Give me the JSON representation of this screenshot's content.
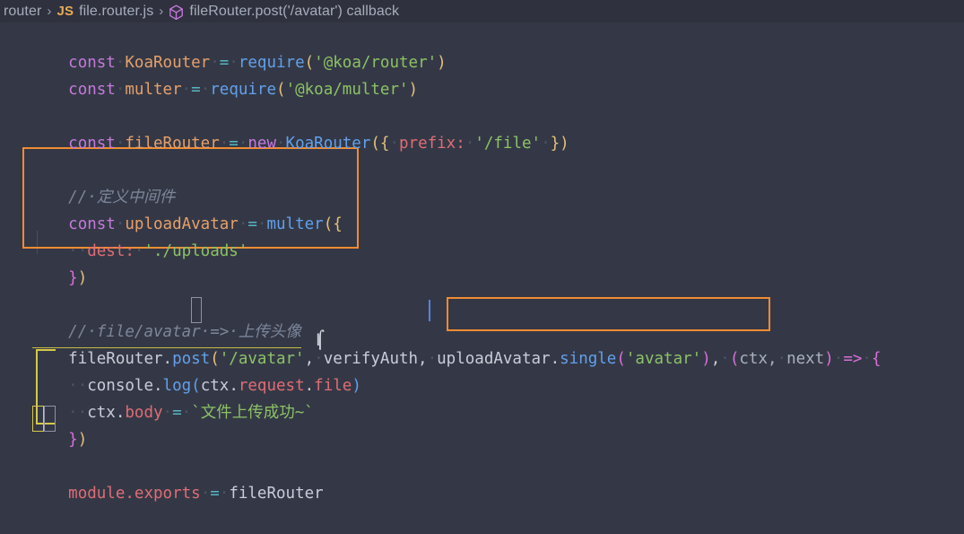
{
  "breadcrumb": {
    "name": "breadcrumb",
    "items": [
      {
        "label": "router",
        "icon": ""
      },
      {
        "label": "file.router.js",
        "icon": "js-icon"
      },
      {
        "label": "fileRouter.post('/avatar') callback",
        "icon": "cube-icon"
      }
    ],
    "separator": "›",
    "js_badge": "JS"
  },
  "colors": {
    "editor_background": "#343846",
    "breadcrumb_background": "#2f323e",
    "highlight_box_border": "#f08c32",
    "keyword": "#c678dd",
    "string": "#8cc265",
    "function": "#62a0ea",
    "property": "#e06c75",
    "comment": "#7c8699",
    "caret": "#5b7fe0",
    "bracket_paren_1": "#e5c07b",
    "bracket_paren_2": "#d86fd9",
    "active_indent_guide": "#d7c94a"
  },
  "code": {
    "line1": {
      "kw": "const",
      "name": "KoaRouter",
      "eq": "=",
      "call": "require",
      "open": "(",
      "arg": "'@koa/router'",
      "close": ")"
    },
    "line2": {
      "kw": "const",
      "name": "multer",
      "eq": "=",
      "call": "require",
      "open": "(",
      "arg": "'@koa/multer'",
      "close": ")"
    },
    "line4": {
      "kw": "const",
      "name": "fileRouter",
      "eq": "=",
      "new": "new",
      "ctor": "KoaRouter",
      "open": "({",
      "key": "prefix:",
      "value": "'/file'",
      "close": "})"
    },
    "line6_comment": "//·定义中间件",
    "line7": {
      "kw": "const",
      "name": "uploadAvatar",
      "eq": "=",
      "call": "multer",
      "open": "({"
    },
    "line8": {
      "key": "dest:",
      "value": "'./uploads'"
    },
    "line9": {
      "close_brace": "}",
      "close_paren": ")"
    },
    "line11_comment": "//·file/avatar·=>·上传头像",
    "line12": {
      "obj": "fileRouter",
      "dot": ".",
      "method": "post",
      "open": "(",
      "arg1": "'/avatar'",
      "comma1": ",",
      "arg2": "verifyAuth",
      "comma2": ",",
      "arg3_obj": "uploadAvatar",
      "arg3_dot": ".",
      "arg3_method": "single",
      "arg3_open": "(",
      "arg3_str": "'avatar'",
      "arg3_close": ")",
      "comma3": ",",
      "params_open": "(",
      "param1": "ctx,",
      "param2": "next",
      "params_close": ")",
      "arrow": "=>",
      "brace": "{"
    },
    "line13": {
      "obj": "console",
      "dot": ".",
      "method": "log",
      "open": "(",
      "a": "ctx",
      "d1": ".",
      "b": "request",
      "d2": ".",
      "c": "file",
      "close": ")"
    },
    "line14": {
      "obj": "ctx",
      "dot": ".",
      "prop": "body",
      "eq": "=",
      "template": "`文件上传成功~`"
    },
    "line15": {
      "close_brace": "}",
      "close_paren": ")"
    },
    "line17": {
      "obj": "module",
      "dot": ".",
      "prop": "exports",
      "eq": "=",
      "value": "fileRouter"
    }
  },
  "annotations": {
    "highlight_box_1_label": "const uploadAvatar = multer({ dest: './uploads' })",
    "highlight_box_2_label": "uploadAvatar.single('avatar'),",
    "caret_position_label": "after verifyAuth",
    "mouse_cursor": "text-ibeam"
  }
}
